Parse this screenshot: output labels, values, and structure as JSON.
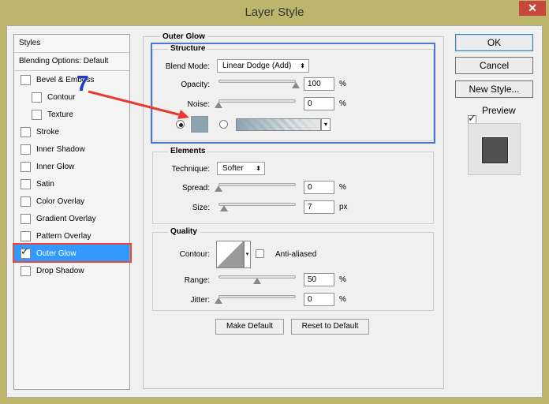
{
  "window": {
    "title": "Layer Style",
    "close_glyph": "✕"
  },
  "styles_panel": {
    "header": "Styles",
    "blending_options": "Blending Options: Default",
    "items": [
      {
        "label": "Bevel & Emboss",
        "checked": false
      },
      {
        "label": "Contour",
        "checked": false
      },
      {
        "label": "Texture",
        "checked": false
      },
      {
        "label": "Stroke",
        "checked": false
      },
      {
        "label": "Inner Shadow",
        "checked": false
      },
      {
        "label": "Inner Glow",
        "checked": false
      },
      {
        "label": "Satin",
        "checked": false
      },
      {
        "label": "Color Overlay",
        "checked": false
      },
      {
        "label": "Gradient Overlay",
        "checked": false
      },
      {
        "label": "Pattern Overlay",
        "checked": false
      },
      {
        "label": "Outer Glow",
        "checked": true
      },
      {
        "label": "Drop Shadow",
        "checked": false
      }
    ]
  },
  "outer_glow": {
    "title": "Outer Glow",
    "structure": {
      "title": "Structure",
      "blend_mode_label": "Blend Mode:",
      "blend_mode_value": "Linear Dodge (Add)",
      "opacity_label": "Opacity:",
      "opacity_value": "100",
      "opacity_level": 1.0,
      "noise_label": "Noise:",
      "noise_value": "0",
      "noise_level": 0,
      "percent": "%",
      "color_swatch": "#8ba4b0",
      "color_radio_selected": true
    },
    "elements": {
      "title": "Elements",
      "technique_label": "Technique:",
      "technique_value": "Softer",
      "spread_label": "Spread:",
      "spread_value": "0",
      "spread_level": 0,
      "size_label": "Size:",
      "size_value": "7",
      "size_level": 0.03,
      "percent": "%",
      "px": "px"
    },
    "quality": {
      "title": "Quality",
      "contour_label": "Contour:",
      "anti_aliased_label": "Anti-aliased",
      "range_label": "Range:",
      "range_value": "50",
      "range_level": 0.5,
      "jitter_label": "Jitter:",
      "jitter_value": "0",
      "jitter_level": 0,
      "percent": "%"
    },
    "make_default": "Make Default",
    "reset_default": "Reset to Default"
  },
  "actions": {
    "ok": "OK",
    "cancel": "Cancel",
    "new_style": "New Style...",
    "preview_label": "Preview",
    "preview_checked": true
  },
  "annotation": {
    "step_number": "7",
    "highlight_color": "#4a7bd0",
    "arrow_color": "#e63b2e",
    "selected_outline_color": "#e54b3c"
  }
}
